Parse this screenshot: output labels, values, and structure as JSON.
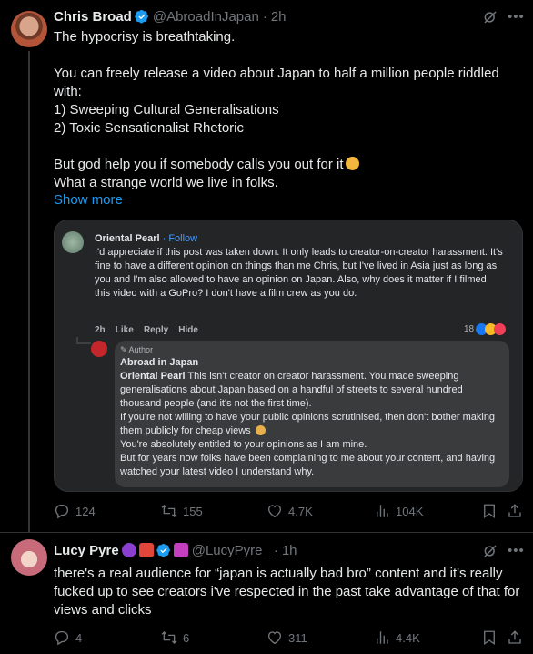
{
  "tweet1": {
    "author_name": "Chris Broad",
    "handle": "@AbroadInJapan",
    "dot": "·",
    "time": "2h",
    "text": "The hypocrisy is breathtaking.\n\nYou can freely release a video about Japan to half a million people riddled with:\n1) Sweeping Cultural Generalisations\n2) Toxic Sensationalist Rhetoric\n\nBut god help you if somebody calls you out for it",
    "text_after_emoji": "What a strange world we live in folks.",
    "emoji_icon": "facepalm-emoji",
    "show_more": "Show more",
    "screenshot": {
      "comment_author": "Oriental Pearl",
      "comment_follow": "· Follow",
      "comment_text": "I'd appreciate if this post was taken down. It only leads to creator-on-creator harassment. It's fine to have a different opinion on things than me Chris, but I've lived in Asia just as long as you and I'm also allowed to have an opinion on Japan. Also, why does it matter if I filmed this video with a GoPro? I don't have a film crew as you do.",
      "comment_time": "2h",
      "comment_like": "Like",
      "comment_reply": "Reply",
      "comment_hide": "Hide",
      "reaction_count": "18",
      "reply_author_badge": "Author",
      "reply_author": "Abroad in Japan",
      "reply_mention": "Oriental Pearl",
      "reply_line1": " This isn't creator on creator harassment. You made sweeping generalisations about Japan based on a handful of streets to several hundred thousand people (and it's not the first time).",
      "reply_line2": "If you're not willing to have your public opinions scrutinised, then don't bother making them publicly for cheap views",
      "reply_line3": "You're absolutely entitled to your opinions as I am mine.",
      "reply_line4": "But for years now folks have been complaining to me about your content, and having watched your latest video I understand why."
    },
    "stats": {
      "replies": "124",
      "reposts": "155",
      "likes": "4.7K",
      "views": "104K"
    }
  },
  "tweet2": {
    "author_name": "Lucy Pyre",
    "handle": "@LucyPyre_",
    "dot": "·",
    "time": "1h",
    "text": "there's a real audience for “japan is actually bad bro” content and it's really fucked up to see creators i've respected in the past take advantage of that for views and clicks",
    "stats": {
      "replies": "4",
      "reposts": "6",
      "likes": "311",
      "views": "4.4K"
    }
  },
  "colors": {
    "accent": "#1d9bf0",
    "secondary_text": "#71767b",
    "background": "#000000",
    "border": "#2f3336"
  }
}
